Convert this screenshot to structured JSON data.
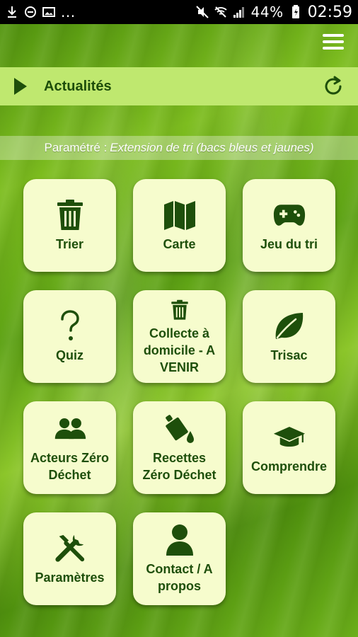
{
  "statusbar": {
    "battery": "44%",
    "time": "02:59",
    "left_dots": "..."
  },
  "colors": {
    "dark_green": "#1e4f0b",
    "tile_bg": "#f6fccd",
    "news_bar_bg": "#bfe86f",
    "status_bg": "#000000"
  },
  "news": {
    "title": "Actualités"
  },
  "setting": {
    "prefix": "Paramétré :",
    "value": "Extension de tri (bacs bleus et jaunes)"
  },
  "tiles": [
    {
      "label": "Trier",
      "icon": "trash-icon"
    },
    {
      "label": "Carte",
      "icon": "map-icon"
    },
    {
      "label": "Jeu du tri",
      "icon": "gamepad-icon"
    },
    {
      "label": "Quiz",
      "icon": "question-icon"
    },
    {
      "label": "Collecte à domicile - A VENIR",
      "icon": "trash-icon"
    },
    {
      "label": "Trisac",
      "icon": "leaf-icon"
    },
    {
      "label": "Acteurs Zéro Déchet",
      "icon": "users-icon"
    },
    {
      "label": "Recettes Zéro Déchet",
      "icon": "fill-drip-icon"
    },
    {
      "label": "Comprendre",
      "icon": "graduation-cap-icon"
    },
    {
      "label": "Paramètres",
      "icon": "tools-icon"
    },
    {
      "label": "Contact / A propos",
      "icon": "user-icon"
    }
  ]
}
